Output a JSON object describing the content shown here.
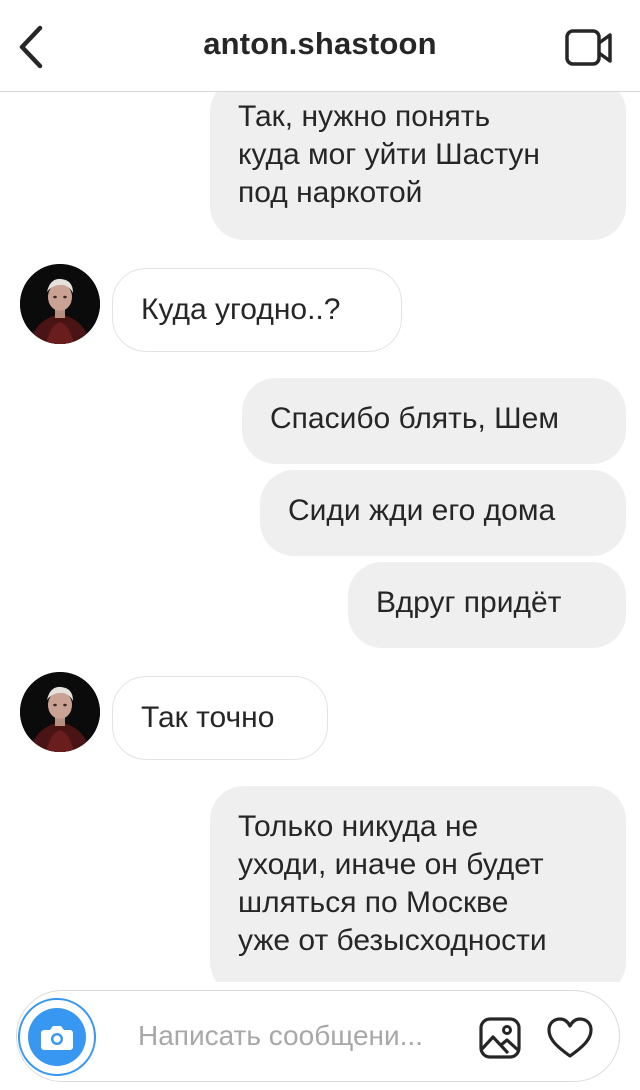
{
  "header": {
    "title": "anton.shastoon",
    "back_icon": "chevron-left-icon",
    "video_icon": "video-camera-icon"
  },
  "messages": [
    {
      "direction": "outgoing",
      "text": "Так, нужно понять\nкуда мог уйти Шастун\nпод наркотой"
    },
    {
      "direction": "incoming",
      "text": "Куда угодно..?"
    },
    {
      "direction": "outgoing",
      "text": "Спасибо блять, Шем"
    },
    {
      "direction": "outgoing",
      "text": "Сиди жди его дома"
    },
    {
      "direction": "outgoing",
      "text": "Вдруг придёт"
    },
    {
      "direction": "incoming",
      "text": "Так точно"
    },
    {
      "direction": "outgoing",
      "text": "Только никуда не\nуходи, иначе он будет\nшляться по Москве\nуже от безысходности"
    }
  ],
  "composer": {
    "placeholder": "Написать сообщени...",
    "camera_icon": "camera-icon",
    "gallery_icon": "image-gallery-icon",
    "heart_icon": "heart-icon"
  },
  "colors": {
    "accent": "#3897f0",
    "outgoing_bubble": "#efefef",
    "text": "#262626",
    "placeholder": "#a8a8a8"
  }
}
